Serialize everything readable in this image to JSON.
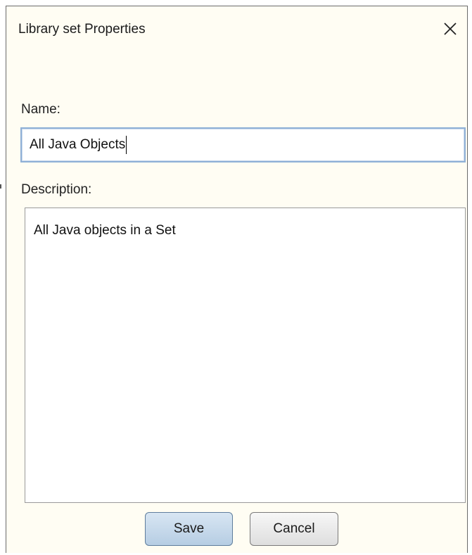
{
  "dialog": {
    "title": "Library set Properties",
    "close_icon": "close-icon"
  },
  "form": {
    "name_label": "Name:",
    "name_value": "All Java Objects",
    "description_label": "Description:",
    "description_value": "All Java objects in a Set"
  },
  "buttons": {
    "save_label": "Save",
    "cancel_label": "Cancel"
  },
  "colors": {
    "dialog_background": "#fffdf3",
    "input_focus_border": "#8fb0d6",
    "save_button_tint": "#c7d9eb"
  }
}
